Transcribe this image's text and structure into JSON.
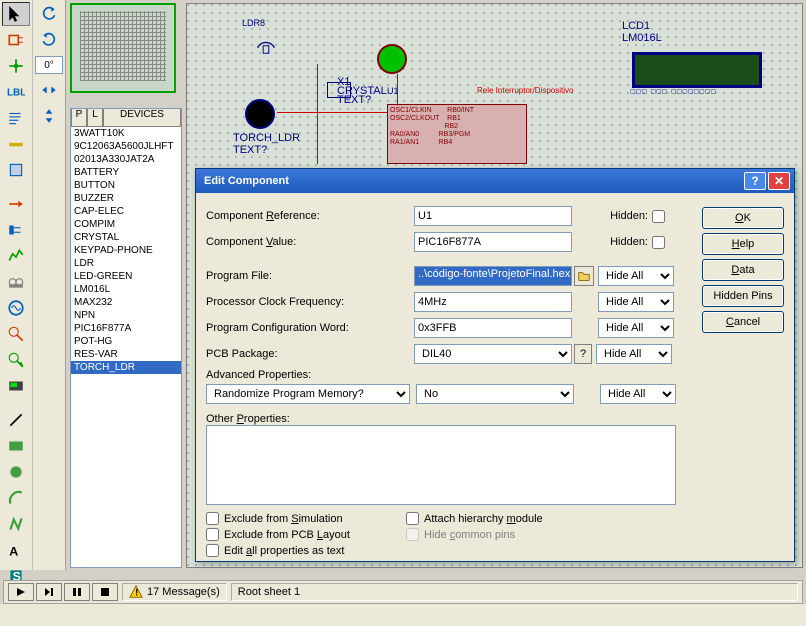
{
  "toolbar": {
    "deg_value": "0°"
  },
  "devices": {
    "tab_p": "P",
    "tab_l": "L",
    "header": "DEVICES",
    "items": [
      "3WATT10K",
      "9C12063A5600JLHFT",
      "02013A330JAT2A",
      "BATTERY",
      "BUTTON",
      "BUZZER",
      "CAP-ELEC",
      "COMPIM",
      "CRYSTAL",
      "KEYPAD-PHONE",
      "LDR",
      "LED-GREEN",
      "LM016L",
      "MAX232",
      "NPN",
      "PIC16F877A",
      "POT-HG",
      "RES-VAR",
      "TORCH_LDR"
    ],
    "selected_index": 18
  },
  "schematic": {
    "lcd_ref": "LCD1",
    "lcd_part": "LM016L",
    "ldr_ref": "LDR8",
    "ic_ref": "U1",
    "crystal_ref": "X1",
    "crystal_part": "CRYSTAL",
    "crystal_text": "TEXT?",
    "relay_text": "Rele Interruptor/Dispositivo",
    "torch_lbl": "TORCH_LDR",
    "torch_text": "TEXT?"
  },
  "dialog": {
    "title": "Edit Component",
    "labels": {
      "comp_ref": "Component Reference:",
      "comp_val": "Component Value:",
      "prog_file": "Program File:",
      "clock_freq": "Processor Clock Frequency:",
      "config_word": "Program Configuration Word:",
      "pcb_pkg": "PCB Package:",
      "adv_props": "Advanced Properties:",
      "other_props": "Other Properties:",
      "hidden": "Hidden:",
      "exclude_sim": "Exclude from Simulation",
      "exclude_pcb": "Exclude from PCB Layout",
      "edit_all": "Edit all properties as text",
      "attach_hier": "Attach hierarchy module",
      "hide_common": "Hide common pins"
    },
    "values": {
      "comp_ref": "U1",
      "comp_val": "PIC16F877A",
      "prog_file": "..\\código-fonte\\ProjetoFinal.hex",
      "clock_freq": "4MHz",
      "config_word": "0x3FFB",
      "pcb_pkg": "DIL40",
      "adv_prop_name": "Randomize Program Memory?",
      "adv_prop_val": "No",
      "hide_all": "Hide All"
    },
    "buttons": {
      "ok": "OK",
      "help": "Help",
      "data": "Data",
      "hidden_pins": "Hidden Pins",
      "cancel": "Cancel"
    }
  },
  "status": {
    "messages": "17 Message(s)",
    "sheet": "Root sheet 1"
  }
}
